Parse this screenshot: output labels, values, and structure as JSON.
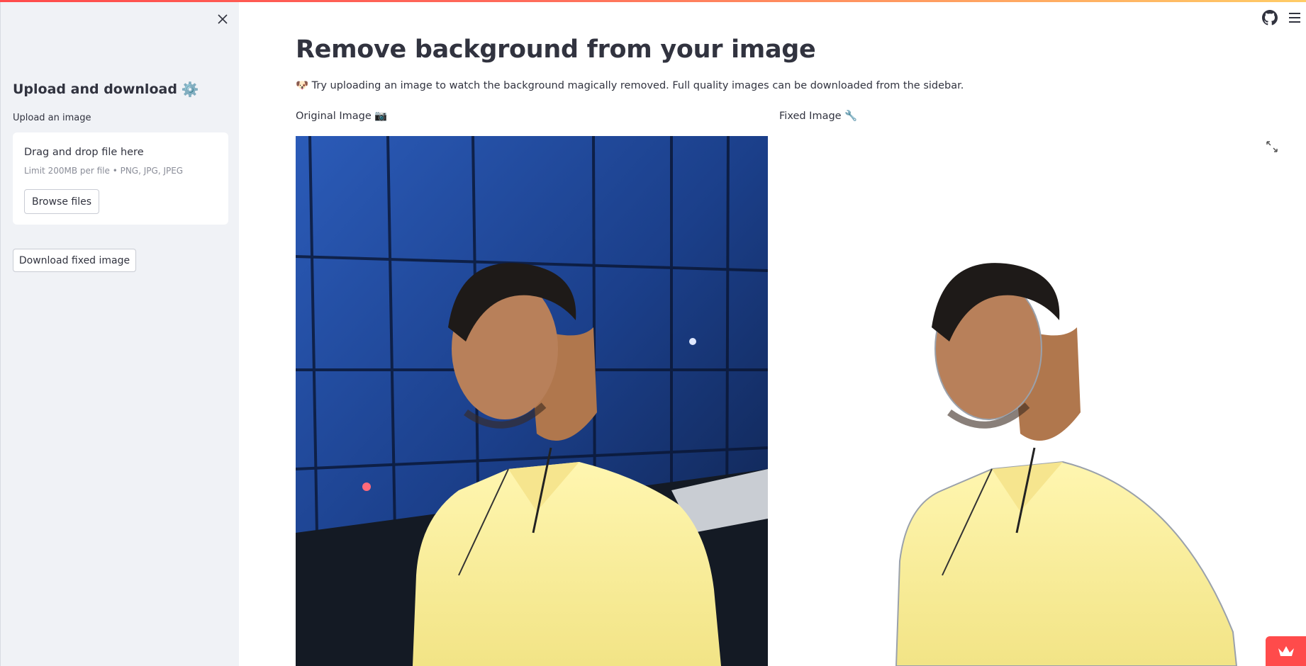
{
  "sidebar": {
    "title": "Upload and download",
    "title_icon": "gear-icon",
    "upload_label": "Upload an image",
    "dropzone": {
      "title": "Drag and drop file here",
      "limit": "Limit 200MB per file • PNG, JPG, JPEG",
      "browse_label": "Browse files"
    },
    "download_label": "Download fixed image"
  },
  "main": {
    "title": "Remove background from your image",
    "intro": "🐶 Try uploading an image to watch the background magically removed. Full quality images can be downloaded from the sidebar.",
    "original_label": "Original Image 📷",
    "fixed_label": "Fixed Image 🔧"
  },
  "colors": {
    "accent": "#ff4b4b",
    "sidebar_bg": "#f0f2f6",
    "text": "#31333F"
  },
  "icons": {
    "close": "close-icon",
    "github": "github-icon",
    "menu": "hamburger-menu-icon",
    "fullscreen": "fullscreen-icon",
    "deploy": "crown-icon"
  }
}
